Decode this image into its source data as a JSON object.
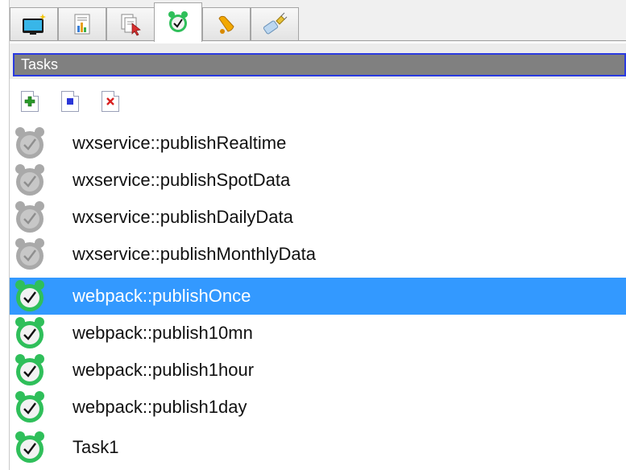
{
  "tabs": [
    {
      "name": "monitor-icon"
    },
    {
      "name": "chart-icon"
    },
    {
      "name": "pages-icon"
    },
    {
      "name": "alarm-clock-icon",
      "active": true
    },
    {
      "name": "bell-icon"
    },
    {
      "name": "plug-icon"
    }
  ],
  "header": {
    "title": "Tasks"
  },
  "toolbar": {
    "add_icon": "plus-icon",
    "stop_icon": "square-icon",
    "delete_icon": "x-icon"
  },
  "tasks": [
    {
      "label": "wxservice::publishRealtime",
      "state": "disabled"
    },
    {
      "label": "wxservice::publishSpotData",
      "state": "disabled"
    },
    {
      "label": "wxservice::publishDailyData",
      "state": "disabled"
    },
    {
      "label": "wxservice::publishMonthlyData",
      "state": "disabled"
    },
    {
      "label": "webpack::publishOnce",
      "state": "enabled",
      "selected": true
    },
    {
      "label": "webpack::publish10mn",
      "state": "enabled"
    },
    {
      "label": "webpack::publish1hour",
      "state": "enabled"
    },
    {
      "label": "webpack::publish1day",
      "state": "enabled"
    },
    {
      "label": "Task1",
      "state": "enabled"
    }
  ],
  "colors": {
    "selection": "#3399ff",
    "header_bg": "#808080",
    "header_border": "#2a3ae0",
    "clock_enabled": "#2fbf5a",
    "clock_disabled": "#a9a9a9"
  }
}
